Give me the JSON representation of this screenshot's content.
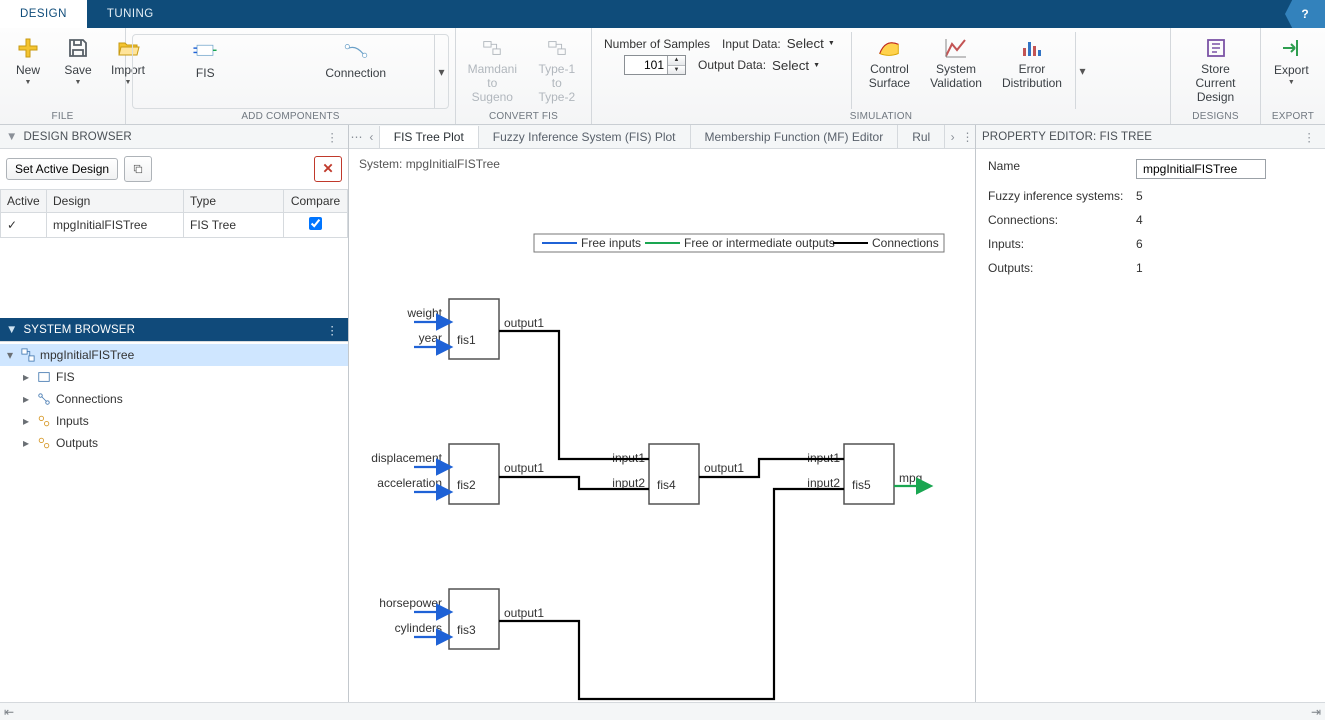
{
  "tabs": {
    "design": "DESIGN",
    "tuning": "TUNING"
  },
  "ribbon": {
    "file": {
      "label": "FILE",
      "new": "New",
      "save": "Save",
      "import": "Import"
    },
    "add": {
      "label": "ADD COMPONENTS",
      "fis": "FIS",
      "connection": "Connection"
    },
    "convert": {
      "label": "CONVERT FIS",
      "mam2sug": "Mamdani\nto Sugeno",
      "t1t2": "Type-1\nto Type-2"
    },
    "sim": {
      "label": "SIMULATION",
      "samples_label": "Number of Samples",
      "samples_value": "101",
      "inputdata_label": "Input Data:",
      "outputdata_label": "Output Data:",
      "select": "Select",
      "control_surface": "Control\nSurface",
      "validation": "System\nValidation",
      "error_dist": "Error\nDistribution"
    },
    "designs": {
      "label": "DESIGNS",
      "store": "Store Current\nDesign"
    },
    "export": {
      "label": "EXPORT",
      "export": "Export"
    }
  },
  "design_browser": {
    "title": "DESIGN BROWSER",
    "set_active": "Set Active Design",
    "cols": {
      "active": "Active",
      "design": "Design",
      "type": "Type",
      "compare": "Compare"
    },
    "rows": [
      {
        "active": "✓",
        "design": "mpgInitialFISTree",
        "type": "FIS Tree",
        "compare": true
      }
    ]
  },
  "system_browser": {
    "title": "SYSTEM BROWSER",
    "root": "mpgInitialFISTree",
    "children": [
      "FIS",
      "Connections",
      "Inputs",
      "Outputs"
    ]
  },
  "doc_tabs": {
    "t1": "FIS Tree Plot",
    "t2": "Fuzzy Inference System (FIS) Plot",
    "t3": "Membership Function (MF) Editor",
    "t4": "Rul"
  },
  "system_label_prefix": "System: ",
  "system_name": "mpgInitialFISTree",
  "legend": {
    "free_inputs": "Free inputs",
    "free_outputs": "Free or intermediate outputs",
    "connections": "Connections"
  },
  "fis_tree": {
    "nodes": {
      "fis1": {
        "label": "fis1",
        "inputs": [
          "weight",
          "year"
        ],
        "outputs": [
          "output1"
        ]
      },
      "fis2": {
        "label": "fis2",
        "inputs": [
          "displacement",
          "acceleration"
        ],
        "outputs": [
          "output1"
        ]
      },
      "fis3": {
        "label": "fis3",
        "inputs": [
          "horsepower",
          "cylinders"
        ],
        "outputs": [
          "output1"
        ]
      },
      "fis4": {
        "label": "fis4",
        "inputs": [
          "input1",
          "input2"
        ],
        "outputs": [
          "output1"
        ]
      },
      "fis5": {
        "label": "fis5",
        "inputs": [
          "input1",
          "input2"
        ],
        "outputs": [
          "mpg"
        ]
      }
    }
  },
  "property_editor": {
    "title": "PROPERTY EDITOR: FIS TREE",
    "name_label": "Name",
    "name_value": "mpgInitialFISTree",
    "rows": [
      {
        "label": "Fuzzy inference systems:",
        "value": "5"
      },
      {
        "label": "Connections:",
        "value": "4"
      },
      {
        "label": "Inputs:",
        "value": "6"
      },
      {
        "label": "Outputs:",
        "value": "1"
      }
    ]
  }
}
